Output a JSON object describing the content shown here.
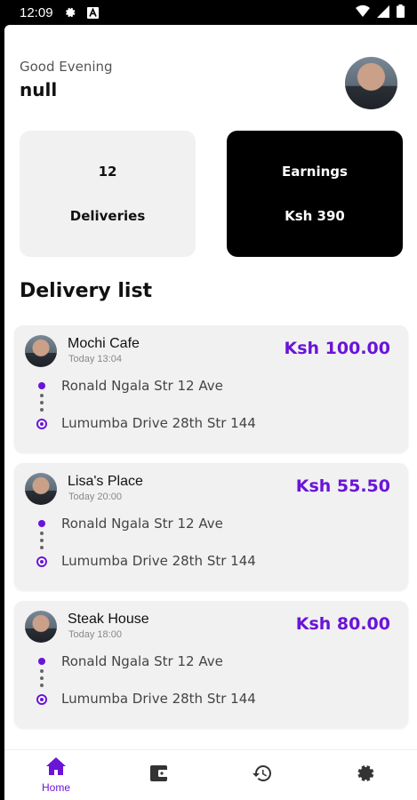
{
  "status_bar": {
    "time": "12:09",
    "icons": [
      "gear-icon",
      "a-badge-icon",
      "wifi-icon",
      "signal-icon",
      "battery-icon"
    ]
  },
  "header": {
    "greeting": "Good Evening",
    "username": "null"
  },
  "stats": {
    "deliveries": {
      "count": "12",
      "label": "Deliveries"
    },
    "earnings": {
      "label": "Earnings",
      "value": "Ksh 390"
    }
  },
  "section_title": "Delivery list",
  "deliveries": [
    {
      "name": "Mochi Cafe",
      "time": "Today 13:04",
      "price": "Ksh 100.00",
      "from": "Ronald Ngala Str 12 Ave",
      "to": "Lumumba Drive 28th Str 144"
    },
    {
      "name": "Lisa's Place",
      "time": "Today 20:00",
      "price": "Ksh 55.50",
      "from": "Ronald Ngala Str 12 Ave",
      "to": "Lumumba Drive 28th Str 144"
    },
    {
      "name": "Steak House",
      "time": "Today 18:00",
      "price": "Ksh 80.00",
      "from": "Ronald Ngala Str 12 Ave",
      "to": "Lumumba Drive 28th Str 144"
    }
  ],
  "nav": {
    "home_label": "Home",
    "items": [
      "home-icon",
      "wallet-icon",
      "history-icon",
      "settings-icon"
    ],
    "active": "home"
  },
  "colors": {
    "accent": "#6a14d8",
    "card_bg": "#f1f1f1",
    "dark_card": "#000000"
  }
}
